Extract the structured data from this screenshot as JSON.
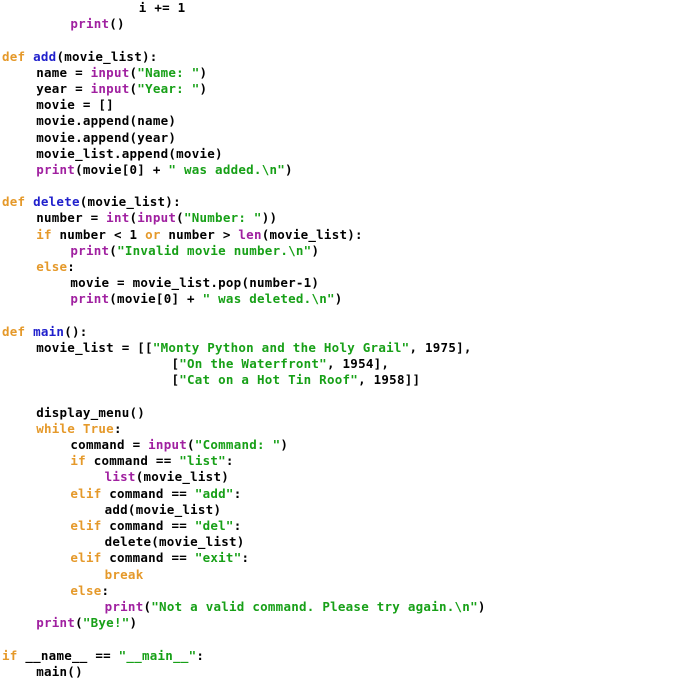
{
  "document": {
    "kind": "python-source-code",
    "language": "Python",
    "background_color": "#ffffff",
    "default_text_color": "#000000"
  },
  "syntax_colors": {
    "keyword": "#e5992a",
    "builtin": "#a020a0",
    "function_name": "#2020cc",
    "string": "#17a017",
    "number": "#000000",
    "plain": "#000000"
  },
  "code": {
    "lines": [
      {
        "indent": 8,
        "tokens": [
          {
            "t": "plain",
            "v": "i += 1"
          }
        ]
      },
      {
        "indent": 4,
        "tokens": [
          {
            "t": "builtin",
            "v": "print"
          },
          {
            "t": "plain",
            "v": "()"
          }
        ]
      },
      {
        "indent": 0,
        "tokens": []
      },
      {
        "indent": 0,
        "tokens": [
          {
            "t": "keyword",
            "v": "def"
          },
          {
            "t": "plain",
            "v": " "
          },
          {
            "t": "function_name",
            "v": "add"
          },
          {
            "t": "plain",
            "v": "(movie_list):"
          }
        ]
      },
      {
        "indent": 2,
        "tokens": [
          {
            "t": "plain",
            "v": "name = "
          },
          {
            "t": "builtin",
            "v": "input"
          },
          {
            "t": "plain",
            "v": "("
          },
          {
            "t": "string",
            "v": "\"Name: \""
          },
          {
            "t": "plain",
            "v": ")"
          }
        ]
      },
      {
        "indent": 2,
        "tokens": [
          {
            "t": "plain",
            "v": "year = "
          },
          {
            "t": "builtin",
            "v": "input"
          },
          {
            "t": "plain",
            "v": "("
          },
          {
            "t": "string",
            "v": "\"Year: \""
          },
          {
            "t": "plain",
            "v": ")"
          }
        ]
      },
      {
        "indent": 2,
        "tokens": [
          {
            "t": "plain",
            "v": "movie = []"
          }
        ]
      },
      {
        "indent": 2,
        "tokens": [
          {
            "t": "plain",
            "v": "movie.append(name)"
          }
        ]
      },
      {
        "indent": 2,
        "tokens": [
          {
            "t": "plain",
            "v": "movie.append(year)"
          }
        ]
      },
      {
        "indent": 2,
        "tokens": [
          {
            "t": "plain",
            "v": "movie_list.append(movie)"
          }
        ]
      },
      {
        "indent": 2,
        "tokens": [
          {
            "t": "builtin",
            "v": "print"
          },
          {
            "t": "plain",
            "v": "(movie[0] + "
          },
          {
            "t": "string",
            "v": "\" was added.\\n\""
          },
          {
            "t": "plain",
            "v": ")"
          }
        ]
      },
      {
        "indent": 0,
        "tokens": []
      },
      {
        "indent": 0,
        "tokens": [
          {
            "t": "keyword",
            "v": "def"
          },
          {
            "t": "plain",
            "v": " "
          },
          {
            "t": "function_name",
            "v": "delete"
          },
          {
            "t": "plain",
            "v": "(movie_list):"
          }
        ]
      },
      {
        "indent": 2,
        "tokens": [
          {
            "t": "plain",
            "v": "number = "
          },
          {
            "t": "builtin",
            "v": "int"
          },
          {
            "t": "plain",
            "v": "("
          },
          {
            "t": "builtin",
            "v": "input"
          },
          {
            "t": "plain",
            "v": "("
          },
          {
            "t": "string",
            "v": "\"Number: \""
          },
          {
            "t": "plain",
            "v": "))"
          }
        ]
      },
      {
        "indent": 2,
        "tokens": [
          {
            "t": "keyword",
            "v": "if"
          },
          {
            "t": "plain",
            "v": " number < 1 "
          },
          {
            "t": "keyword",
            "v": "or"
          },
          {
            "t": "plain",
            "v": " number > "
          },
          {
            "t": "builtin",
            "v": "len"
          },
          {
            "t": "plain",
            "v": "(movie_list):"
          }
        ]
      },
      {
        "indent": 4,
        "tokens": [
          {
            "t": "builtin",
            "v": "print"
          },
          {
            "t": "plain",
            "v": "("
          },
          {
            "t": "string",
            "v": "\"Invalid movie number.\\n\""
          },
          {
            "t": "plain",
            "v": ")"
          }
        ]
      },
      {
        "indent": 2,
        "tokens": [
          {
            "t": "keyword",
            "v": "else"
          },
          {
            "t": "plain",
            "v": ":"
          }
        ]
      },
      {
        "indent": 4,
        "tokens": [
          {
            "t": "plain",
            "v": "movie = movie_list.pop(number-1)"
          }
        ]
      },
      {
        "indent": 4,
        "tokens": [
          {
            "t": "builtin",
            "v": "print"
          },
          {
            "t": "plain",
            "v": "(movie[0] + "
          },
          {
            "t": "string",
            "v": "\" was deleted.\\n\""
          },
          {
            "t": "plain",
            "v": ")"
          }
        ]
      },
      {
        "indent": 0,
        "tokens": []
      },
      {
        "indent": 0,
        "tokens": [
          {
            "t": "keyword",
            "v": "def"
          },
          {
            "t": "plain",
            "v": " "
          },
          {
            "t": "function_name",
            "v": "main"
          },
          {
            "t": "plain",
            "v": "():"
          }
        ]
      },
      {
        "indent": 2,
        "tokens": [
          {
            "t": "plain",
            "v": "movie_list = [["
          },
          {
            "t": "string",
            "v": "\"Monty Python and the Holy Grail\""
          },
          {
            "t": "plain",
            "v": ", "
          },
          {
            "t": "number",
            "v": "1975"
          },
          {
            "t": "plain",
            "v": "],"
          }
        ]
      },
      {
        "indent": 9,
        "tokens": [
          {
            "t": "plain",
            "v": "  ["
          },
          {
            "t": "string",
            "v": "\"On the Waterfront\""
          },
          {
            "t": "plain",
            "v": ", "
          },
          {
            "t": "number",
            "v": "1954"
          },
          {
            "t": "plain",
            "v": "],"
          }
        ]
      },
      {
        "indent": 9,
        "tokens": [
          {
            "t": "plain",
            "v": "  ["
          },
          {
            "t": "string",
            "v": "\"Cat on a Hot Tin Roof\""
          },
          {
            "t": "plain",
            "v": ", "
          },
          {
            "t": "number",
            "v": "1958"
          },
          {
            "t": "plain",
            "v": "]]"
          }
        ]
      },
      {
        "indent": 0,
        "tokens": []
      },
      {
        "indent": 2,
        "tokens": [
          {
            "t": "plain",
            "v": "display_menu()"
          }
        ]
      },
      {
        "indent": 2,
        "tokens": [
          {
            "t": "keyword",
            "v": "while"
          },
          {
            "t": "plain",
            "v": " "
          },
          {
            "t": "keyword",
            "v": "True"
          },
          {
            "t": "plain",
            "v": ":"
          }
        ]
      },
      {
        "indent": 4,
        "tokens": [
          {
            "t": "plain",
            "v": "command = "
          },
          {
            "t": "builtin",
            "v": "input"
          },
          {
            "t": "plain",
            "v": "("
          },
          {
            "t": "string",
            "v": "\"Command: \""
          },
          {
            "t": "plain",
            "v": ")"
          }
        ]
      },
      {
        "indent": 4,
        "tokens": [
          {
            "t": "keyword",
            "v": "if"
          },
          {
            "t": "plain",
            "v": " command == "
          },
          {
            "t": "string",
            "v": "\"list\""
          },
          {
            "t": "plain",
            "v": ":"
          }
        ]
      },
      {
        "indent": 6,
        "tokens": [
          {
            "t": "builtin",
            "v": "list"
          },
          {
            "t": "plain",
            "v": "(movie_list)"
          }
        ]
      },
      {
        "indent": 4,
        "tokens": [
          {
            "t": "keyword",
            "v": "elif"
          },
          {
            "t": "plain",
            "v": " command == "
          },
          {
            "t": "string",
            "v": "\"add\""
          },
          {
            "t": "plain",
            "v": ":"
          }
        ]
      },
      {
        "indent": 6,
        "tokens": [
          {
            "t": "plain",
            "v": "add(movie_list)"
          }
        ]
      },
      {
        "indent": 4,
        "tokens": [
          {
            "t": "keyword",
            "v": "elif"
          },
          {
            "t": "plain",
            "v": " command == "
          },
          {
            "t": "string",
            "v": "\"del\""
          },
          {
            "t": "plain",
            "v": ":"
          }
        ]
      },
      {
        "indent": 6,
        "tokens": [
          {
            "t": "plain",
            "v": "delete(movie_list)"
          }
        ]
      },
      {
        "indent": 4,
        "tokens": [
          {
            "t": "keyword",
            "v": "elif"
          },
          {
            "t": "plain",
            "v": " command == "
          },
          {
            "t": "string",
            "v": "\"exit\""
          },
          {
            "t": "plain",
            "v": ":"
          }
        ]
      },
      {
        "indent": 6,
        "tokens": [
          {
            "t": "keyword",
            "v": "break"
          }
        ]
      },
      {
        "indent": 4,
        "tokens": [
          {
            "t": "keyword",
            "v": "else"
          },
          {
            "t": "plain",
            "v": ":"
          }
        ]
      },
      {
        "indent": 6,
        "tokens": [
          {
            "t": "builtin",
            "v": "print"
          },
          {
            "t": "plain",
            "v": "("
          },
          {
            "t": "string",
            "v": "\"Not a valid command. Please try again.\\n\""
          },
          {
            "t": "plain",
            "v": ")"
          }
        ]
      },
      {
        "indent": 2,
        "tokens": [
          {
            "t": "builtin",
            "v": "print"
          },
          {
            "t": "plain",
            "v": "("
          },
          {
            "t": "string",
            "v": "\"Bye!\""
          },
          {
            "t": "plain",
            "v": ")"
          }
        ]
      },
      {
        "indent": 0,
        "tokens": []
      },
      {
        "indent": 0,
        "tokens": [
          {
            "t": "keyword",
            "v": "if"
          },
          {
            "t": "plain",
            "v": " __name__ == "
          },
          {
            "t": "string",
            "v": "\"__main__\""
          },
          {
            "t": "plain",
            "v": ":"
          }
        ]
      },
      {
        "indent": 2,
        "tokens": [
          {
            "t": "plain",
            "v": "main()"
          }
        ]
      }
    ]
  }
}
